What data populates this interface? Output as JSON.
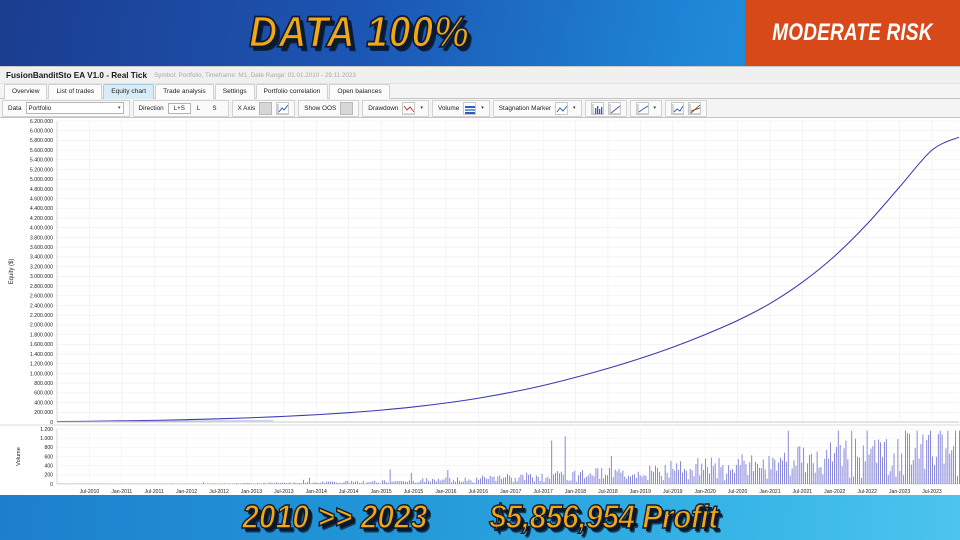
{
  "top_banner": {
    "headline": "DATA 100%",
    "risk_label": "MODERATE RISK",
    "risk_color": "#d8491a"
  },
  "window": {
    "title": "FusionBanditSto EA V1.0 - Real Tick",
    "subtitle": "Symbol: Portfolio, Timeframe: M1, Date Range: 01.01.2010 - 29.11.2023"
  },
  "tabs": [
    {
      "label": "Overview",
      "active": false
    },
    {
      "label": "List of trades",
      "active": false
    },
    {
      "label": "Equity chart",
      "active": true
    },
    {
      "label": "Trade analysis",
      "active": false
    },
    {
      "label": "Settings",
      "active": false
    },
    {
      "label": "Portfolio correlation",
      "active": false
    },
    {
      "label": "Open balances",
      "active": false
    }
  ],
  "toolbar": {
    "data_label": "Data",
    "data_value": "Portfolio",
    "direction_label": "Direction",
    "direction_options": [
      "L+S",
      "L",
      "S"
    ],
    "direction_selected": "L+S",
    "xaxis_label": "X Axis",
    "show_oos_label": "Show OOS",
    "drawdown_label": "Drawdown",
    "volume_label": "Volume",
    "stagnation_label": "Stagnation Marker"
  },
  "chart_data": {
    "type": "line",
    "title": "",
    "xlabel": "",
    "ylabel": "Equity ($)",
    "ylim": [
      0,
      6200000
    ],
    "ytick_step": 200000,
    "yticks": [
      "6.200.000",
      "6.000.000",
      "5.800.000",
      "5.600.000",
      "5.400.000",
      "5.200.000",
      "5.000.000",
      "4.800.000",
      "4.600.000",
      "4.400.000",
      "4.200.000",
      "4.000.000",
      "3.800.000",
      "3.600.000",
      "3.400.000",
      "3.200.000",
      "3.000.000",
      "2.800.000",
      "2.600.000",
      "2.400.000",
      "2.200.000",
      "2.000.000",
      "1.800.000",
      "1.600.000",
      "1.400.000",
      "1.200.000",
      "1.000.000",
      "800.000",
      "600.000",
      "400.000",
      "200.000",
      "0"
    ],
    "xticks": [
      "Jul-2010",
      "Jan-2011",
      "Jul-2011",
      "Jan-2012",
      "Jul-2012",
      "Jan-2013",
      "Jul-2013",
      "Jan-2014",
      "Jul-2014",
      "Jan-2015",
      "Jul-2015",
      "Jan-2016",
      "Jul-2016",
      "Jan-2017",
      "Jul-2017",
      "Jan-2018",
      "Jul-2018",
      "Jan-2019",
      "Jul-2019",
      "Jan-2020",
      "Jul-2020",
      "Jan-2021",
      "Jul-2021",
      "Jan-2022",
      "Jul-2022",
      "Jan-2023",
      "Jul-2023"
    ],
    "series": [
      {
        "name": "Equity",
        "color": "#3a3ab4",
        "x": [
          "2010-01",
          "2010-07",
          "2011-01",
          "2011-07",
          "2012-01",
          "2012-07",
          "2013-01",
          "2013-07",
          "2014-01",
          "2014-07",
          "2015-01",
          "2015-07",
          "2016-01",
          "2016-07",
          "2017-01",
          "2017-07",
          "2018-01",
          "2018-07",
          "2019-01",
          "2019-07",
          "2020-01",
          "2020-07",
          "2021-01",
          "2021-07",
          "2022-01",
          "2022-07",
          "2023-01",
          "2023-07",
          "2023-11"
        ],
        "values": [
          10000,
          16000,
          24000,
          34000,
          48000,
          66000,
          88000,
          116000,
          150000,
          192000,
          244000,
          310000,
          392000,
          490000,
          610000,
          752000,
          920000,
          1105000,
          1310000,
          1540000,
          1800000,
          2090000,
          2440000,
          2880000,
          3420000,
          4080000,
          4840000,
          5600000,
          5866954
        ]
      }
    ],
    "volume_panel": {
      "ylabel": "Volume",
      "ylim": [
        0,
        1200
      ],
      "yticks": [
        "1.200",
        "1.000",
        "800",
        "600",
        "400",
        "200",
        "0"
      ],
      "color": "#5a5ad0",
      "type": "bar"
    },
    "grid": true,
    "legend": "none"
  },
  "bottom_banner": {
    "range": "2010 >> 2023",
    "profit": "$5,856,954 Profit"
  }
}
